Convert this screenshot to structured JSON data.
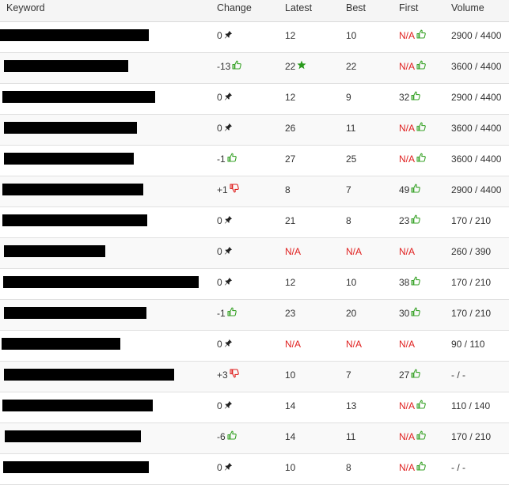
{
  "headers": {
    "keyword": "Keyword",
    "change": "Change",
    "latest": "Latest",
    "best": "Best",
    "first": "First",
    "volume": "Volume"
  },
  "colors": {
    "na_red": "#e0201f",
    "thumb_green": "#3aa32a",
    "thumb_red": "#e0201f",
    "star_green": "#2a9a1d"
  },
  "rows": [
    {
      "change": "0",
      "change_icon": "pin-icon",
      "latest": "12",
      "latest_icon": "",
      "best": "10",
      "first": "N/A",
      "first_icon": "thumbs-up-icon",
      "volume": "2900 / 4400"
    },
    {
      "change": "-13",
      "change_icon": "thumbs-up-icon",
      "latest": "22",
      "latest_icon": "star-icon",
      "best": "22",
      "first": "N/A",
      "first_icon": "thumbs-up-icon",
      "volume": "3600 / 4400"
    },
    {
      "change": "0",
      "change_icon": "pin-icon",
      "latest": "12",
      "latest_icon": "",
      "best": "9",
      "first": "32",
      "first_icon": "thumbs-up-icon",
      "volume": "2900 / 4400"
    },
    {
      "change": "0",
      "change_icon": "pin-icon",
      "latest": "26",
      "latest_icon": "",
      "best": "11",
      "first": "N/A",
      "first_icon": "thumbs-up-icon",
      "volume": "3600 / 4400"
    },
    {
      "change": "-1",
      "change_icon": "thumbs-up-icon",
      "latest": "27",
      "latest_icon": "",
      "best": "25",
      "first": "N/A",
      "first_icon": "thumbs-up-icon",
      "volume": "3600 / 4400"
    },
    {
      "change": "+1",
      "change_icon": "thumbs-down-icon",
      "latest": "8",
      "latest_icon": "",
      "best": "7",
      "first": "49",
      "first_icon": "thumbs-up-icon",
      "volume": "2900 / 4400"
    },
    {
      "change": "0",
      "change_icon": "pin-icon",
      "latest": "21",
      "latest_icon": "",
      "best": "8",
      "first": "23",
      "first_icon": "thumbs-up-icon",
      "volume": "170 / 210"
    },
    {
      "change": "0",
      "change_icon": "pin-icon",
      "latest": "N/A",
      "latest_icon": "",
      "best": "N/A",
      "first": "N/A",
      "first_icon": "",
      "volume": "260 / 390"
    },
    {
      "change": "0",
      "change_icon": "pin-icon",
      "latest": "12",
      "latest_icon": "",
      "best": "10",
      "first": "38",
      "first_icon": "thumbs-up-icon",
      "volume": "170 / 210"
    },
    {
      "change": "-1",
      "change_icon": "thumbs-up-icon",
      "latest": "23",
      "latest_icon": "",
      "best": "20",
      "first": "30",
      "first_icon": "thumbs-up-icon",
      "volume": "170 / 210"
    },
    {
      "change": "0",
      "change_icon": "pin-icon",
      "latest": "N/A",
      "latest_icon": "",
      "best": "N/A",
      "first": "N/A",
      "first_icon": "",
      "volume": "90 / 110"
    },
    {
      "change": "+3",
      "change_icon": "thumbs-down-icon",
      "latest": "10",
      "latest_icon": "",
      "best": "7",
      "first": "27",
      "first_icon": "thumbs-up-icon",
      "volume": "- / -"
    },
    {
      "change": "0",
      "change_icon": "pin-icon",
      "latest": "14",
      "latest_icon": "",
      "best": "13",
      "first": "N/A",
      "first_icon": "thumbs-up-icon",
      "volume": "110 / 140"
    },
    {
      "change": "-6",
      "change_icon": "thumbs-up-icon",
      "latest": "14",
      "latest_icon": "",
      "best": "11",
      "first": "N/A",
      "first_icon": "thumbs-up-icon",
      "volume": "170 / 210"
    },
    {
      "change": "0",
      "change_icon": "pin-icon",
      "latest": "10",
      "latest_icon": "",
      "best": "8",
      "first": "N/A",
      "first_icon": "thumbs-up-icon",
      "volume": "- / -"
    }
  ]
}
